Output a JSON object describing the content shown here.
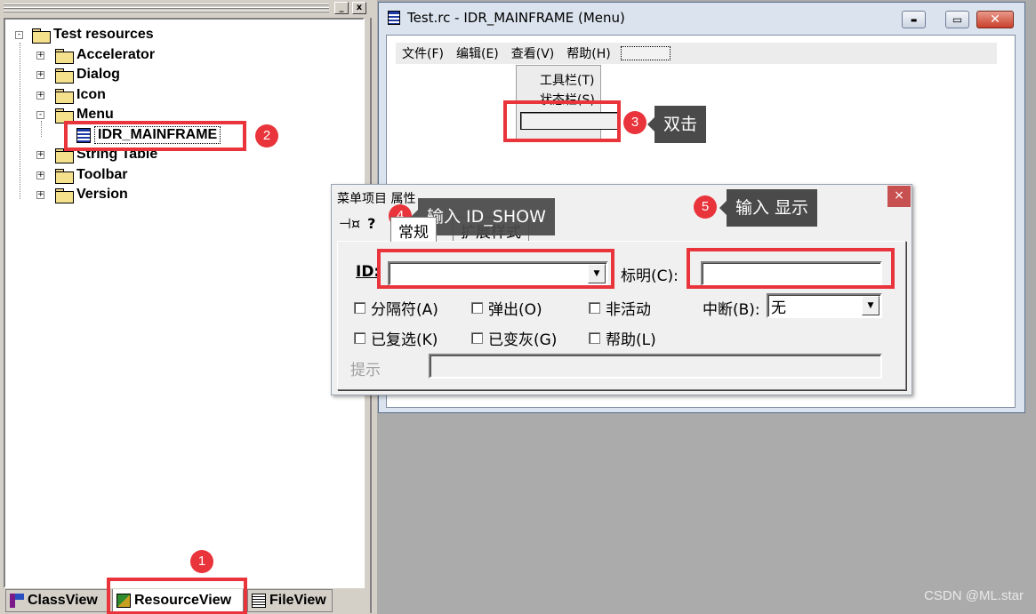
{
  "workspace": {
    "pane_buttons": [
      "_",
      "x"
    ],
    "tree": {
      "root": "Test resources",
      "items": [
        {
          "label": "Accelerator",
          "expander": "+"
        },
        {
          "label": "Dialog",
          "expander": "+"
        },
        {
          "label": "Icon",
          "expander": "+"
        },
        {
          "label": "Menu",
          "expander": "-"
        },
        {
          "label": "String Table",
          "expander": "+"
        },
        {
          "label": "Toolbar",
          "expander": "+"
        },
        {
          "label": "Version",
          "expander": "+"
        }
      ],
      "root_expander": "-",
      "menu_child": "IDR_MAINFRAME"
    },
    "tabs": [
      "ClassView",
      "ResourceView",
      "FileView"
    ]
  },
  "editor": {
    "title": "Test.rc - IDR_MAINFRAME (Menu)",
    "window_buttons": {
      "minimize": "▬",
      "maximize": "▭",
      "close": "✕"
    },
    "menubar": [
      "文件(F)",
      "编辑(E)",
      "查看(V)",
      "帮助(H)"
    ],
    "dropdown": [
      "工具栏(T)",
      "状态栏(S)"
    ]
  },
  "props": {
    "title": "菜单项目 属性",
    "close": "×",
    "tool_pin": "⊣¤",
    "tool_help": "?",
    "tabs": [
      "常规",
      "扩展样式"
    ],
    "id_label": "ID:",
    "id_value": "",
    "caption_label": "标明(C):",
    "caption_value": "",
    "checks_row1": [
      "分隔符(A)",
      "弹出(O)",
      "非活动"
    ],
    "checks_row2": [
      "已复选(K)",
      "已变灰(G)",
      "帮助(L)"
    ],
    "break_label": "中断(B):",
    "break_value": "无",
    "prompt_label": "提示",
    "prompt_value": ""
  },
  "annotations": {
    "badges": [
      "1",
      "2",
      "3",
      "4",
      "5"
    ],
    "callout_3": "双击",
    "callout_4": "输入 ID_SHOW",
    "callout_5": "输入  显示",
    "accent": "#e8343a"
  },
  "watermark": "CSDN @ML.star"
}
